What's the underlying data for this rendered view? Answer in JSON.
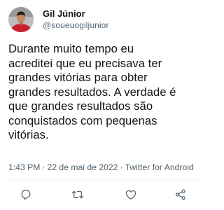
{
  "author": {
    "display_name": "Gil Júnior",
    "handle": "@soueuogiljunior"
  },
  "tweet": {
    "text": "Durante muito tempo eu\nacreditei que eu precisava ter\ngrandes vitórias para obter\ngrandes resultados. A verdade é\nque grandes resultados são\nconquistados com pequenas\nvitórias."
  },
  "meta": {
    "time": "1:43 PM",
    "date": "22 de mai de 2022",
    "source": "Twitter for Android",
    "separator": "·"
  },
  "actions": {
    "icons": [
      "reply-icon",
      "retweet-icon",
      "like-icon",
      "share-icon"
    ]
  },
  "colors": {
    "text_primary": "#0f1419",
    "text_secondary": "#536471",
    "divider": "#eff3f4"
  }
}
